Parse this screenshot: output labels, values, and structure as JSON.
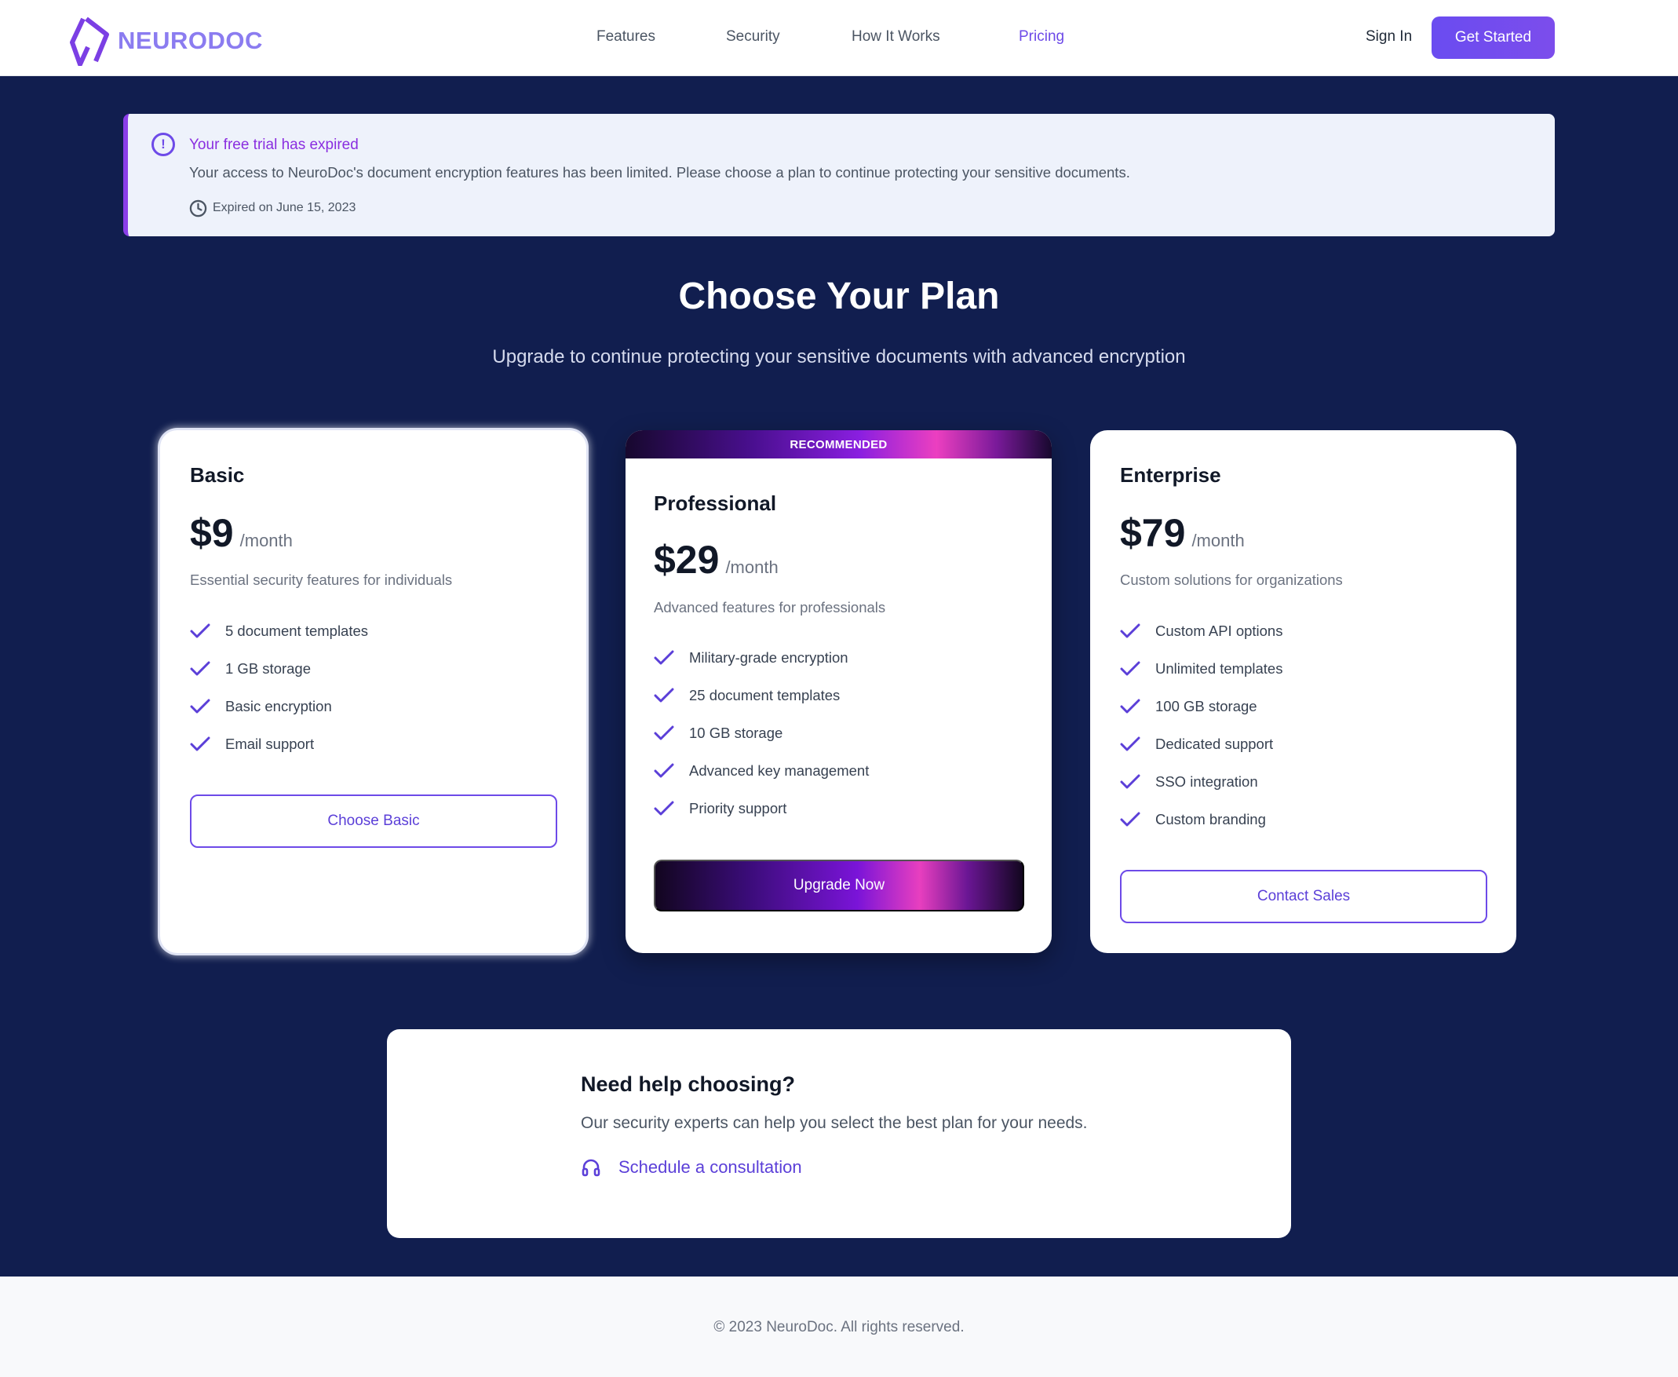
{
  "brand": {
    "name": "NEURODOC",
    "color": "#8b7cf0"
  },
  "nav": {
    "items": [
      {
        "label": "Features",
        "active": false
      },
      {
        "label": "Security",
        "active": false
      },
      {
        "label": "How It Works",
        "active": false
      },
      {
        "label": "Pricing",
        "active": true
      }
    ],
    "sign_in": "Sign In",
    "get_started": "Get Started"
  },
  "banner": {
    "icon": "alert-circle-icon",
    "title": "Your free trial has expired",
    "message": "Your access to NeuroDoc's document encryption features has been limited. Please choose a plan to continue protecting your sensitive documents.",
    "expired": "Expired on June 15, 2023"
  },
  "heading": {
    "title": "Choose Your Plan",
    "subtitle": "Upgrade to continue protecting your sensitive documents with advanced encryption"
  },
  "plans": [
    {
      "name": "Basic",
      "price": "$9",
      "period": "/month",
      "description": "Essential security features for individuals",
      "features": [
        "5 document templates",
        "1 GB storage",
        "Basic encryption",
        "Email support"
      ],
      "cta": "Choose Basic"
    },
    {
      "badge": "RECOMMENDED",
      "name": "Professional",
      "price": "$29",
      "period": "/month",
      "description": "Advanced features for professionals",
      "features": [
        "Military-grade encryption",
        "25 document templates",
        "10 GB storage",
        "Advanced key management",
        "Priority support"
      ],
      "cta": "Upgrade Now"
    },
    {
      "name": "Enterprise",
      "price": "$79",
      "period": "/month",
      "description": "Custom solutions for organizations",
      "features": [
        "Custom API options",
        "Unlimited templates",
        "100 GB storage",
        "Dedicated support",
        "SSO integration",
        "Custom branding"
      ],
      "cta": "Contact Sales"
    }
  ],
  "help": {
    "title": "Need help choosing?",
    "text": "Our security experts can help you select the best plan for your needs.",
    "link": "Schedule a consultation",
    "icon": "headset-icon"
  },
  "footer": {
    "text": "© 2023 NeuroDoc. All rights reserved."
  },
  "colors": {
    "accent": "#6d4ae8",
    "background": "#111e4f",
    "alert": "#8a2ee0"
  }
}
